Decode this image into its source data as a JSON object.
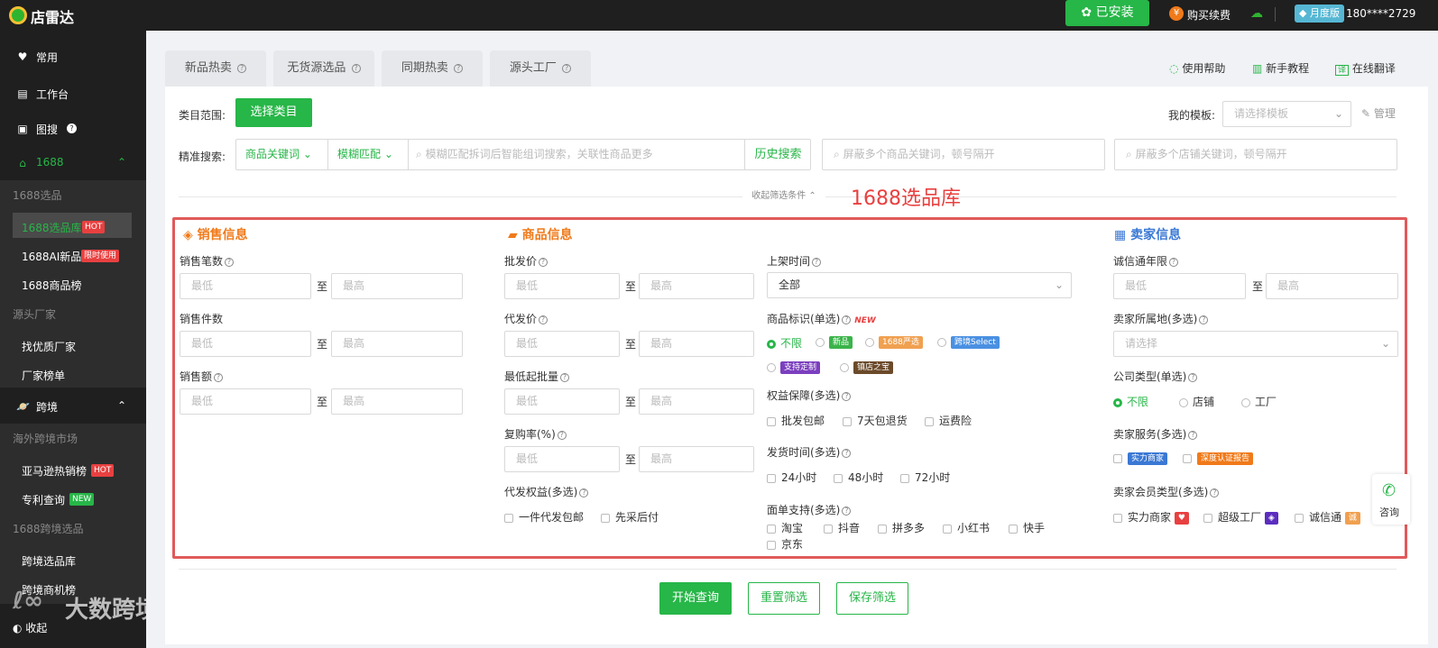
{
  "top": {
    "logo": "店雷达",
    "install": "已安装",
    "renew": "购买续费",
    "vip": "月度版",
    "phone": "180****2729"
  },
  "sidebar": {
    "fav": "常用",
    "workbench": "工作台",
    "imgsearch": "图搜",
    "g1688": "1688",
    "sub1": "1688选品",
    "sel_lib": "1688选品库",
    "hot": "HOT",
    "ai_new": "1688AI新品",
    "limited": "限时使用",
    "rank": "1688商品榜",
    "sub2": "源头厂家",
    "find_factory": "找优质厂家",
    "factory_rank": "厂家榜单",
    "crossborder": "跨境",
    "sub3": "海外跨境市场",
    "amazon": "亚马逊热销榜",
    "hot2": "HOT",
    "patent": "专利查询",
    "new": "NEW",
    "sub4": "1688跨境选品",
    "cb_lib": "跨境选品库",
    "cb_op": "跨境商机榜",
    "collapse": "收起"
  },
  "tabs": [
    "新品热卖",
    "无货源选品",
    "同期热卖",
    "源头工厂"
  ],
  "help": {
    "use": "使用帮助",
    "tutorial": "新手教程",
    "translate": "在线翻译"
  },
  "filter": {
    "category_label": "类目范围:",
    "category_btn": "选择类目",
    "template_label": "我的模板:",
    "template_ph": "请选择模板",
    "manage": "管理",
    "search_label": "精准搜索:",
    "kw_type": "商品关键词",
    "match": "模糊匹配",
    "search_ph": "模糊匹配拆词后智能组词搜索，关联性商品更多",
    "history": "历史搜索",
    "block_goods_ph": "屏蔽多个商品关键词，顿号隔开",
    "block_shop_ph": "屏蔽多个店铺关键词，顿号隔开",
    "collapse": "收起筛选条件",
    "annotation": "1688选品库"
  },
  "sales": {
    "title": "销售信息",
    "count": "销售笔数",
    "pieces": "销售件数",
    "amount": "销售额"
  },
  "goods": {
    "title": "商品信息",
    "wholesale": "批发价",
    "dropship": "代发价",
    "min_batch": "最低起批量",
    "repurchase": "复购率(%)",
    "ds_rights": "代发权益(多选)",
    "ds1": "一件代发包邮",
    "ds2": "先采后付"
  },
  "mid": {
    "list_time": "上架时间",
    "list_time_val": "全部",
    "mark": "商品标识(单选)",
    "new_tag": "NEW",
    "m_all": "不限",
    "m_new": "新品",
    "m_yx": "1688严选",
    "m_cb": "跨境Select",
    "m_custom": "支持定制",
    "m_shop": "镇店之宝",
    "rights": "权益保障(多选)",
    "r1": "批发包邮",
    "r2": "7天包退货",
    "r3": "运费险",
    "ship": "发货时间(多选)",
    "s1": "24小时",
    "s2": "48小时",
    "s3": "72小时",
    "waybill": "面单支持(多选)",
    "w1": "淘宝",
    "w2": "抖音",
    "w3": "拼多多",
    "w4": "小红书",
    "w5": "快手",
    "w6": "京东"
  },
  "seller": {
    "title": "卖家信息",
    "years": "诚信通年限",
    "location": "卖家所属地(多选)",
    "location_ph": "请选择",
    "ctype": "公司类型(单选)",
    "c1": "不限",
    "c2": "店铺",
    "c3": "工厂",
    "service": "卖家服务(多选)",
    "sv1": "实力商家",
    "sv1tag": "实力商家",
    "sv2tag": "深度认证报告",
    "member": "卖家会员类型(多选)",
    "mb1": "实力商家",
    "mb2": "超级工厂",
    "mb3": "诚信通"
  },
  "placeholders": {
    "min": "最低",
    "max": "最高",
    "to": "至"
  },
  "actions": {
    "search": "开始查询",
    "reset": "重置筛选",
    "save": "保存筛选"
  },
  "consult": "咨询",
  "watermark": "大数跨境"
}
